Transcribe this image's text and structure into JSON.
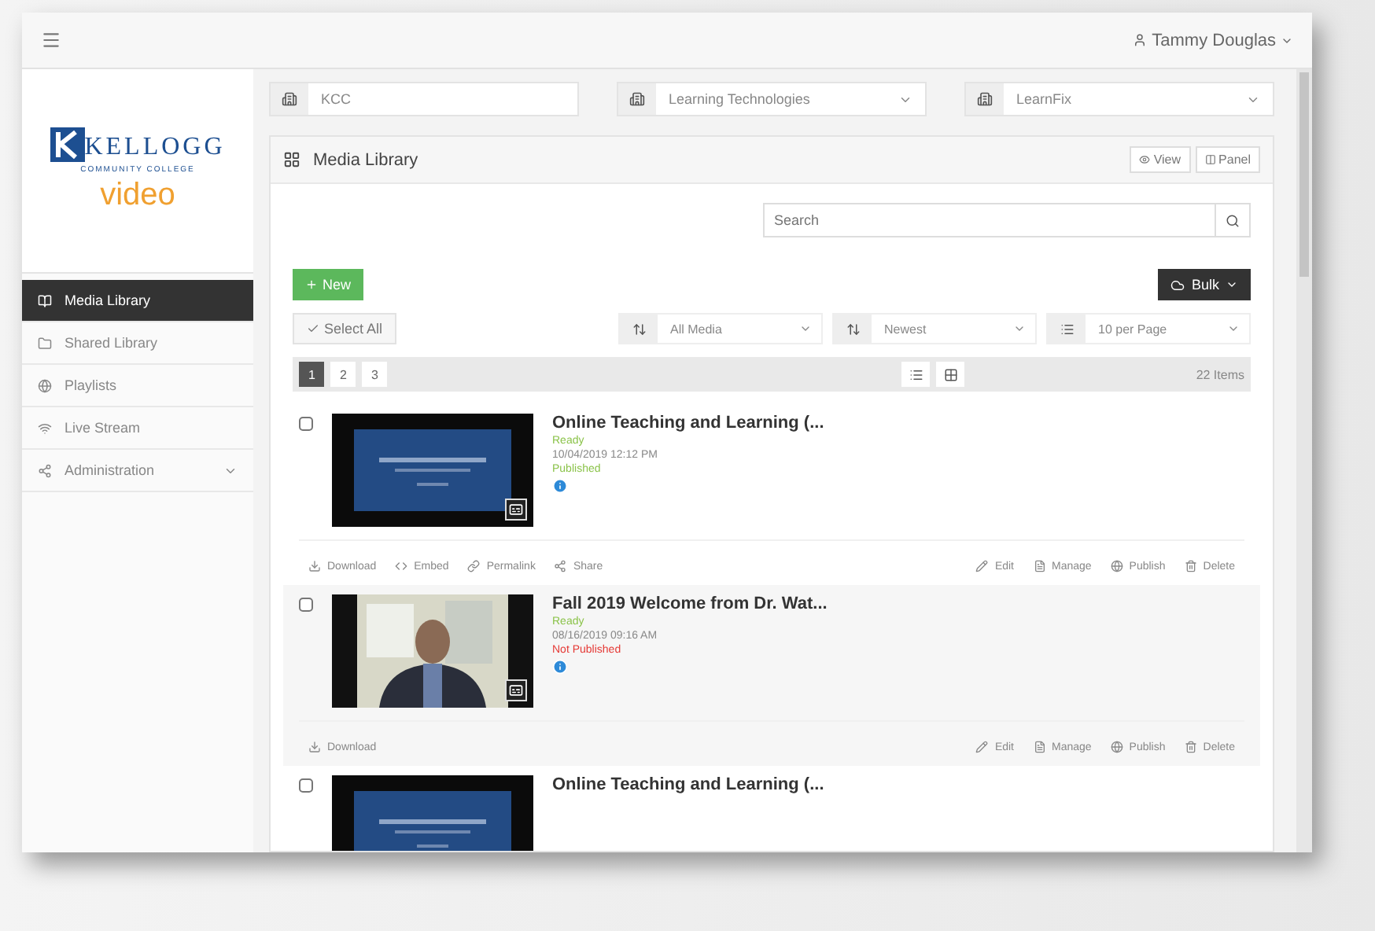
{
  "top_bar": {
    "user": "Tammy Douglas"
  },
  "logo": {
    "name": "KELLOGG",
    "subtitle": "COMMUNITY COLLEGE",
    "product": "video"
  },
  "sidebar": {
    "items": [
      {
        "label": "Media Library",
        "selected": true,
        "expandable": false
      },
      {
        "label": "Shared Library",
        "selected": false,
        "expandable": false
      },
      {
        "label": "Playlists",
        "selected": false,
        "expandable": false
      },
      {
        "label": "Live Stream",
        "selected": false,
        "expandable": false
      },
      {
        "label": "Administration",
        "selected": false,
        "expandable": true
      }
    ]
  },
  "filters": [
    {
      "value": "KCC",
      "dropdown": false
    },
    {
      "value": "Learning Technologies",
      "dropdown": true
    },
    {
      "value": "LearnFix",
      "dropdown": true
    }
  ],
  "panel": {
    "title": "Media Library",
    "header_buttons": [
      "View",
      "Panel"
    ],
    "search": {
      "placeholder": "Search"
    },
    "new_button": "New",
    "bulk_button": "Bulk",
    "select_all": "Select All",
    "sorts": [
      {
        "value": "All Media"
      },
      {
        "value": "Newest"
      },
      {
        "value": "10 per Page"
      }
    ],
    "pages": [
      {
        "label": "1",
        "selected": true
      },
      {
        "label": "2",
        "selected": false
      },
      {
        "label": "3",
        "selected": false
      }
    ],
    "count": "22 Items",
    "media": [
      {
        "title": "Online Teaching and Learning (...",
        "checked": false,
        "status": "Ready",
        "date": "10/04/2019 12:12 PM",
        "published": true,
        "publish_label": "Published",
        "left_actions": [
          "Download",
          "Embed",
          "Permalink",
          "Share"
        ],
        "right_actions": [
          "Edit",
          "Manage",
          "Publish",
          "Delete"
        ]
      },
      {
        "title": "Fall 2019 Welcome from Dr. Wat...",
        "checked": false,
        "status": "Ready",
        "date": "08/16/2019 09:16 AM",
        "published": false,
        "publish_label": "Not Published",
        "left_actions": [
          "Download"
        ],
        "right_actions": [
          "Edit",
          "Manage",
          "Publish",
          "Delete"
        ]
      },
      {
        "title": "Online Teaching and Learning (...",
        "checked": false
      }
    ]
  }
}
